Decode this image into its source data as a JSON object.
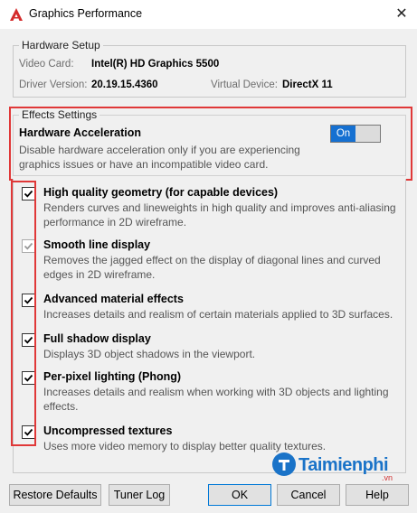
{
  "window": {
    "title": "Graphics Performance",
    "close_label": "✕"
  },
  "hardware": {
    "legend": "Hardware Setup",
    "video_card_label": "Video Card:",
    "video_card_value": "Intel(R) HD Graphics 5500",
    "driver_label": "Driver Version:",
    "driver_value": "20.19.15.4360",
    "virtual_label": "Virtual Device:",
    "virtual_value": "DirectX 11"
  },
  "effects": {
    "legend": "Effects Settings",
    "title": "Hardware Acceleration",
    "description": "Disable hardware acceleration only if you are experiencing graphics issues or have an incompatible video card.",
    "toggle_label": "On",
    "toggle_on": true
  },
  "options": [
    {
      "title": "High quality geometry (for capable devices)",
      "desc": "Renders curves and lineweights in high quality and improves anti-aliasing performance in 2D wireframe.",
      "checked": true,
      "enabled": true
    },
    {
      "title": "Smooth line display",
      "desc": "Removes the jagged effect on the display of diagonal lines and curved edges in 2D wireframe.",
      "checked": true,
      "enabled": false
    },
    {
      "title": "Advanced material effects",
      "desc": "Increases details and realism of certain materials applied to 3D surfaces.",
      "checked": true,
      "enabled": true
    },
    {
      "title": "Full shadow display",
      "desc": "Displays 3D object shadows in the viewport.",
      "checked": true,
      "enabled": true
    },
    {
      "title": "Per-pixel lighting (Phong)",
      "desc": "Increases details and realism when working with 3D objects and lighting effects.",
      "checked": true,
      "enabled": true
    },
    {
      "title": "Uncompressed textures",
      "desc": "Uses more video memory to display better quality textures.",
      "checked": true,
      "enabled": true
    }
  ],
  "buttons": {
    "restore_defaults": "Restore Defaults",
    "tuner_log": "Tuner Log",
    "ok": "OK",
    "cancel": "Cancel",
    "help": "Help"
  },
  "watermark": {
    "text": "Taimienphi",
    "suffix": ".vn"
  },
  "colors": {
    "accent": "#1570d1",
    "highlight_red": "#e03838"
  }
}
